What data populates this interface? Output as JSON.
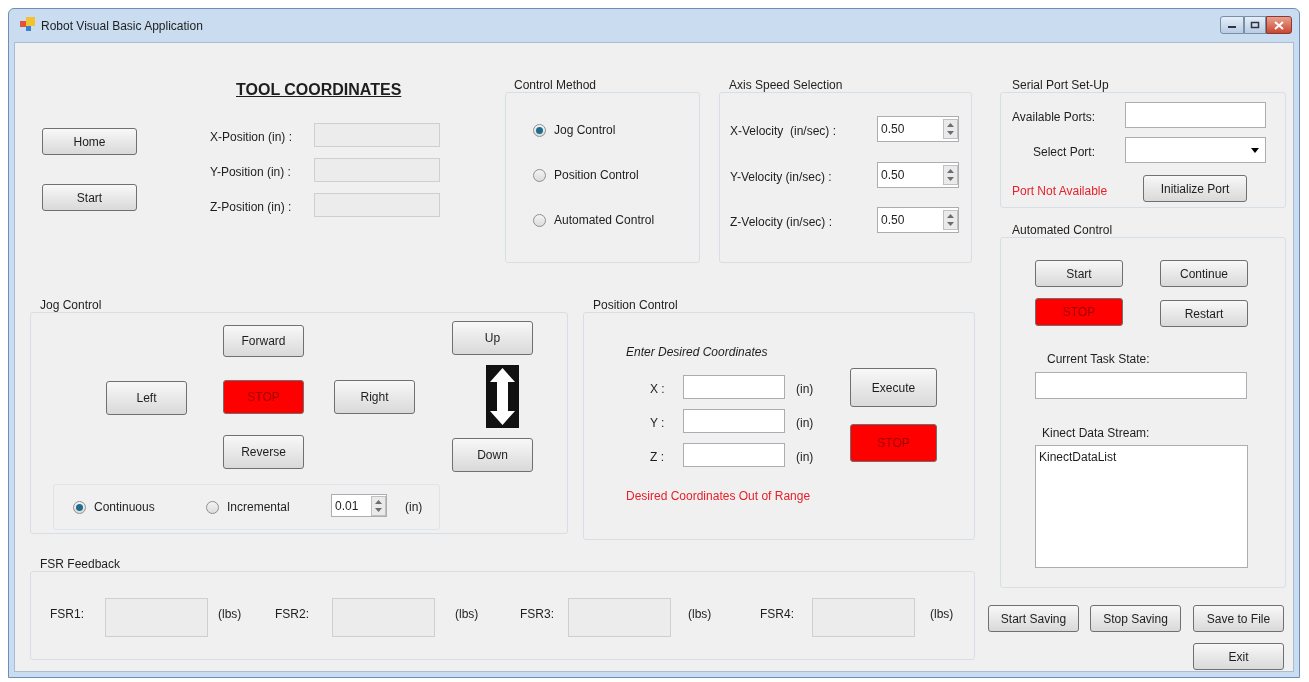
{
  "window": {
    "title": "Robot Visual Basic Application"
  },
  "tool_coordinates": {
    "heading": "TOOL COORDINATES",
    "buttons": [
      "Home",
      "Start"
    ],
    "fields": [
      {
        "label": "X-Position (in) :"
      },
      {
        "label": "Y-Position (in) :"
      },
      {
        "label": "Z-Position (in) :"
      }
    ]
  },
  "control_method": {
    "title": "Control Method",
    "options": [
      {
        "label": "Jog Control",
        "selected": true
      },
      {
        "label": "Position Control",
        "selected": false
      },
      {
        "label": "Automated Control",
        "selected": false
      }
    ]
  },
  "axis_speed": {
    "title": "Axis Speed Selection",
    "rows": [
      {
        "label": "X-Velocity  (in/sec) :",
        "value": "0.50"
      },
      {
        "label": "Y-Velocity (in/sec) :",
        "value": "0.50"
      },
      {
        "label": "Z-Velocity (in/sec) :",
        "value": "0.50"
      }
    ]
  },
  "serial_port": {
    "title": "Serial Port Set-Up",
    "available_label": "Available Ports:",
    "select_label": "Select Port:",
    "status": "Port Not Available",
    "button": "Initialize Port"
  },
  "automated_control": {
    "title": "Automated Control",
    "buttons": [
      {
        "label": "Start",
        "kind": "normal"
      },
      {
        "label": "Continue",
        "kind": "normal"
      },
      {
        "label": "STOP",
        "kind": "stop"
      },
      {
        "label": "Restart",
        "kind": "normal"
      }
    ],
    "task_state_label": "Current Task State:",
    "stream_label": "Kinect Data Stream:",
    "stream_items": [
      "KinectDataList"
    ]
  },
  "jog_control": {
    "title": "Jog Control",
    "buttons": [
      {
        "label": "Forward",
        "kind": "normal"
      },
      {
        "label": "Left",
        "kind": "normal"
      },
      {
        "label": "STOP",
        "kind": "stop"
      },
      {
        "label": "Right",
        "kind": "normal"
      },
      {
        "label": "Reverse",
        "kind": "normal"
      },
      {
        "label": "Up",
        "kind": "normal"
      },
      {
        "label": "Down",
        "kind": "normal"
      }
    ],
    "modes": [
      {
        "label": "Continuous",
        "selected": true
      },
      {
        "label": "Incremental",
        "selected": false
      }
    ],
    "increment": "0.01",
    "unit": "(in)"
  },
  "position_control": {
    "title": "Position Control",
    "instruction": "Enter Desired Coordinates",
    "fields": [
      {
        "label": "X :",
        "unit": "(in)"
      },
      {
        "label": "Y :",
        "unit": "(in)"
      },
      {
        "label": "Z :",
        "unit": "(in)"
      }
    ],
    "buttons": [
      {
        "label": "Execute",
        "kind": "normal"
      },
      {
        "label": "STOP",
        "kind": "stop"
      }
    ],
    "error": "Desired Coordinates Out of Range"
  },
  "fsr_feedback": {
    "title": "FSR Feedback",
    "sensors": [
      {
        "label": "FSR1:",
        "unit": "(lbs)"
      },
      {
        "label": "FSR2:",
        "unit": "(lbs)"
      },
      {
        "label": "FSR3:",
        "unit": "(lbs)"
      },
      {
        "label": "FSR4:",
        "unit": "(lbs)"
      }
    ]
  },
  "footer_buttons": [
    "Start Saving",
    "Stop Saving",
    "Save to File",
    "Exit"
  ]
}
